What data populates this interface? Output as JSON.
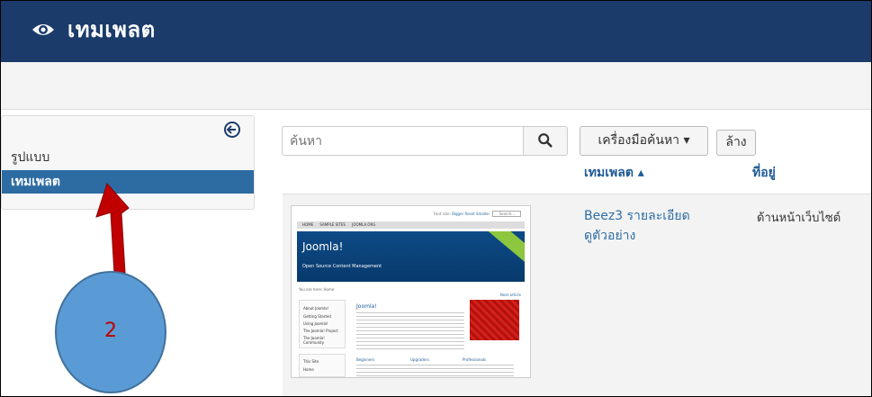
{
  "header": {
    "title": "เทมเพลต",
    "icon": "eye-icon",
    "color": "#1b3b6b"
  },
  "sidebar": {
    "items": [
      {
        "label": "รูปแบบ"
      },
      {
        "label": "เทมเพลต",
        "active": true
      }
    ]
  },
  "search": {
    "placeholder": "ค้นหา"
  },
  "buttons": {
    "search_tools": "เครื่องมือค้นหา ▾",
    "clear": "ล้าง"
  },
  "table": {
    "columns": [
      "เทมเพลต ▴",
      "ที่อยู่"
    ],
    "rows": [
      {
        "name_line1": "Beez3 รายละเอียด",
        "name_line2": "ดูตัวอย่าง",
        "location": "ด้านหน้าเว็บไซต์"
      }
    ]
  },
  "thumbnail": {
    "brand": "Joomla!",
    "tagline": "Open Source Content Management",
    "nav": [
      "HOME",
      "SAMPLE SITES",
      "JOOMLA.ORG"
    ],
    "top_links": [
      "Font size:",
      "Bigger",
      "Reset",
      "Smaller",
      "Search..."
    ],
    "breadcrumb": "You are here: Home",
    "next_link": "Next article",
    "about_heading": "About Joomla!",
    "about_items": [
      "Getting Started",
      "Using Joomla!",
      "The Joomla! Project",
      "The Joomla! Community"
    ],
    "article_title": "Joomla!",
    "site_heading": "This Site",
    "site_items": [
      "Home"
    ],
    "col_headings": [
      "Beginners",
      "Upgraders",
      "Professionals"
    ]
  },
  "annotation": {
    "label": "2",
    "circle_color": "#5b9bd5",
    "arrow_color": "#c00000"
  }
}
